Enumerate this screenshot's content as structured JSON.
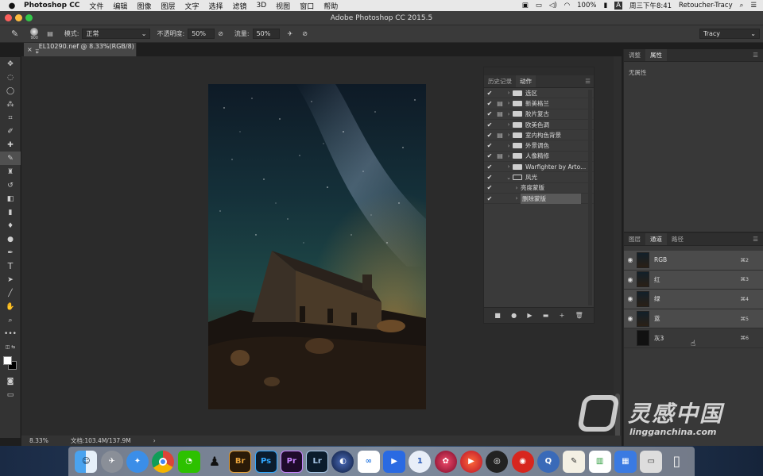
{
  "menubar": {
    "app_name": "Photoshop CC",
    "items": [
      "文件",
      "编辑",
      "图像",
      "图层",
      "文字",
      "选择",
      "滤镜",
      "3D",
      "视图",
      "窗口",
      "帮助"
    ],
    "battery": "100%",
    "input_method": "A",
    "datetime": "周三下午8:41",
    "user": "Retoucher-Tracy"
  },
  "window": {
    "title": "Adobe Photoshop CC 2015.5"
  },
  "options_bar": {
    "brush_size": "900",
    "mode_label": "模式:",
    "mode_value": "正常",
    "opacity_label": "不透明度:",
    "opacity_value": "50%",
    "flow_label": "流量:",
    "flow_value": "50%",
    "workspace": "Tracy"
  },
  "document": {
    "tab_title": "_EL10290.nef @ 8.33%(RGB/8) *"
  },
  "status_bar": {
    "zoom": "8.33%",
    "doc_size": "文档:103.4M/137.9M",
    "arrow": "›"
  },
  "actions_panel": {
    "tabs": [
      "历史记录",
      "动作"
    ],
    "active_tab": "动作",
    "rows": [
      {
        "label": "选区",
        "dialog": false,
        "level": 0
      },
      {
        "label": "新美格兰",
        "dialog": true,
        "level": 0
      },
      {
        "label": "胶片复古",
        "dialog": true,
        "level": 0
      },
      {
        "label": "欧美色调",
        "dialog": false,
        "level": 0
      },
      {
        "label": "室内构色背景",
        "dialog": true,
        "level": 0
      },
      {
        "label": "外景调色",
        "dialog": false,
        "level": 0
      },
      {
        "label": "人像精修",
        "dialog": true,
        "level": 0
      },
      {
        "label": "Warfighter by Arto...",
        "dialog": false,
        "level": 0
      },
      {
        "label": "风光",
        "dialog": false,
        "level": 0,
        "open": true
      },
      {
        "label": "亮度蒙版",
        "dialog": false,
        "level": 1
      },
      {
        "label": "删除蒙版",
        "dialog": false,
        "level": 1,
        "selected": true
      }
    ],
    "bottom_buttons": [
      "■",
      "●",
      "▶",
      "▬",
      "+",
      "🗑"
    ]
  },
  "properties_panel": {
    "tabs": [
      "调整",
      "属性"
    ],
    "active_tab": "属性",
    "body_text": "无属性"
  },
  "channels_panel": {
    "tabs": [
      "图层",
      "通道",
      "路径"
    ],
    "active_tab": "通道",
    "channels": [
      {
        "name": "RGB",
        "shortcut": "⌘2",
        "visible": true
      },
      {
        "name": "红",
        "shortcut": "⌘3",
        "visible": true
      },
      {
        "name": "绿",
        "shortcut": "⌘4",
        "visible": true
      },
      {
        "name": "蓝",
        "shortcut": "⌘5",
        "visible": true
      },
      {
        "name": "灰3",
        "shortcut": "⌘6",
        "visible": false
      }
    ]
  },
  "dock": {
    "apps": [
      "Finder",
      "Launchpad",
      "Safari",
      "Chrome",
      "WeChat",
      "QQ",
      "Br",
      "Ps",
      "Pr",
      "Lr",
      "Cinema4D",
      "Baidu",
      "Video",
      "Info",
      "Resolve",
      "Player",
      "OBS",
      "NetEase",
      "QuickTime",
      "TextEdit",
      "Numbers",
      "Keynote",
      "Preview",
      "Trash"
    ]
  },
  "watermark": {
    "cn": "灵感中国",
    "url": "lingganchina.com"
  },
  "colors": {
    "accent": "#4a90d9",
    "panel_bg": "#383838",
    "canvas_bg": "#2b2b2b"
  }
}
